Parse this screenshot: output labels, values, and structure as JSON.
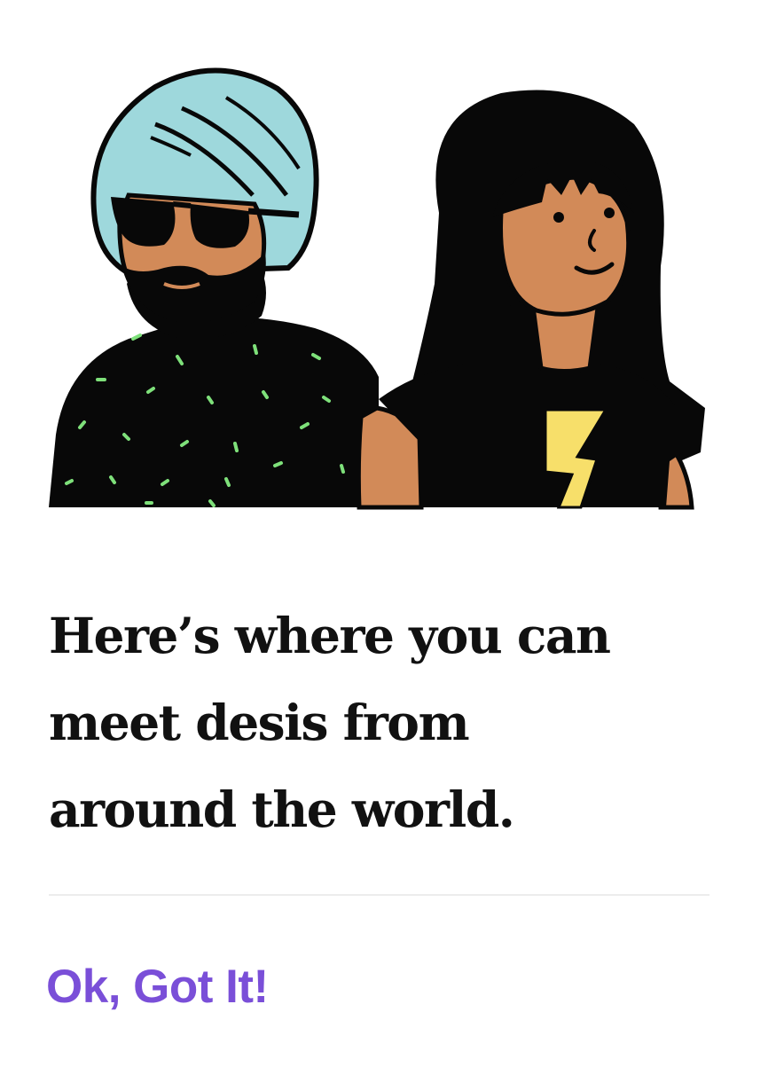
{
  "dialog": {
    "headline_lines": [
      "Here’s where you can",
      "meet desis from",
      "around the world."
    ],
    "confirm_label": "Ok, Got It!",
    "illustration": {
      "name": "two-people-illustration",
      "people": [
        "person-with-turban-and-sunglasses",
        "person-with-long-black-hair"
      ]
    }
  },
  "colors": {
    "accent": "#7a4fd8",
    "text": "#111111",
    "divider": "#ececec",
    "turban": "#9ed8dc",
    "skin": "#d28a58",
    "lightning": "#f7df6a",
    "speckle": "#7ee07a"
  }
}
